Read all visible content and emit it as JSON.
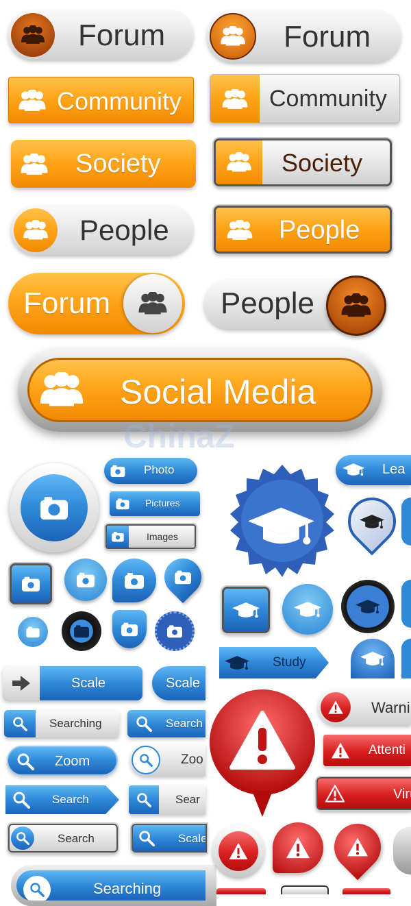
{
  "people_buttons": {
    "forum_1": "Forum",
    "forum_2": "Forum",
    "community_1": "Community",
    "community_2": "Community",
    "society_1": "Society",
    "society_2": "Society",
    "people_1": "People",
    "people_2": "People",
    "forum_3": "Forum",
    "people_3": "People",
    "social_media": "Social Media"
  },
  "watermark": "ChinaZ",
  "camera_buttons": {
    "photo": "Photo",
    "pictures": "Pictures",
    "images": "Images"
  },
  "education_buttons": {
    "learn": "Lea",
    "study": "Study"
  },
  "search_buttons": {
    "scale_1": "Scale",
    "scale_2": "Scale",
    "searching_1": "Searching",
    "search_partial_1": "Search",
    "zoom_1": "Zoom",
    "zoom_partial": "Zoo",
    "search_1": "Search",
    "search_partial_2": "Sear",
    "search_2": "Search",
    "scale_partial": "Scale",
    "searching_2": "Searching"
  },
  "warning_buttons": {
    "warning": "Warni",
    "attention": "Attenti",
    "virus": "Virus"
  },
  "colors": {
    "orange": "#f7960f",
    "gray": "#e2e2e2",
    "blue": "#2a7fd4",
    "red": "#d41c1c",
    "brown_icon": "#a3420b"
  }
}
